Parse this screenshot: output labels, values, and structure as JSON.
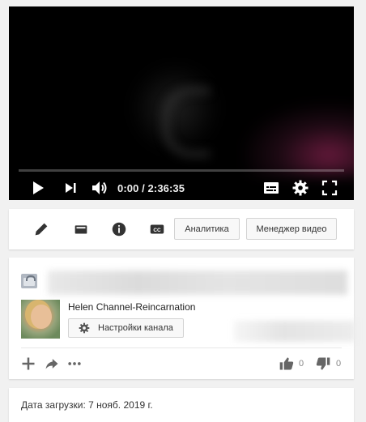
{
  "player": {
    "time_display": "0:00 / 2:36:35",
    "icons": {
      "play": "play-icon",
      "next": "next-icon",
      "volume": "volume-icon",
      "subtitles": "subtitles-icon",
      "settings": "gear-icon",
      "fullscreen": "fullscreen-icon"
    }
  },
  "toolbar": {
    "icons": [
      "pencil-icon",
      "card-icon",
      "info-icon",
      "cc-icon"
    ],
    "analytics_label": "Аналитика",
    "video_manager_label": "Менеджер видео"
  },
  "video_info": {
    "channel_name": "Helen Channel-Reincarnation",
    "channel_settings_label": "Настройки канала",
    "likes": "0",
    "dislikes": "0",
    "upload_date": "Дата загрузки: 7 нояб. 2019 г."
  },
  "colors": {
    "player_bg": "#000000",
    "page_bg": "#f1f1f1",
    "card_bg": "#ffffff",
    "icon_gray": "#666666"
  }
}
